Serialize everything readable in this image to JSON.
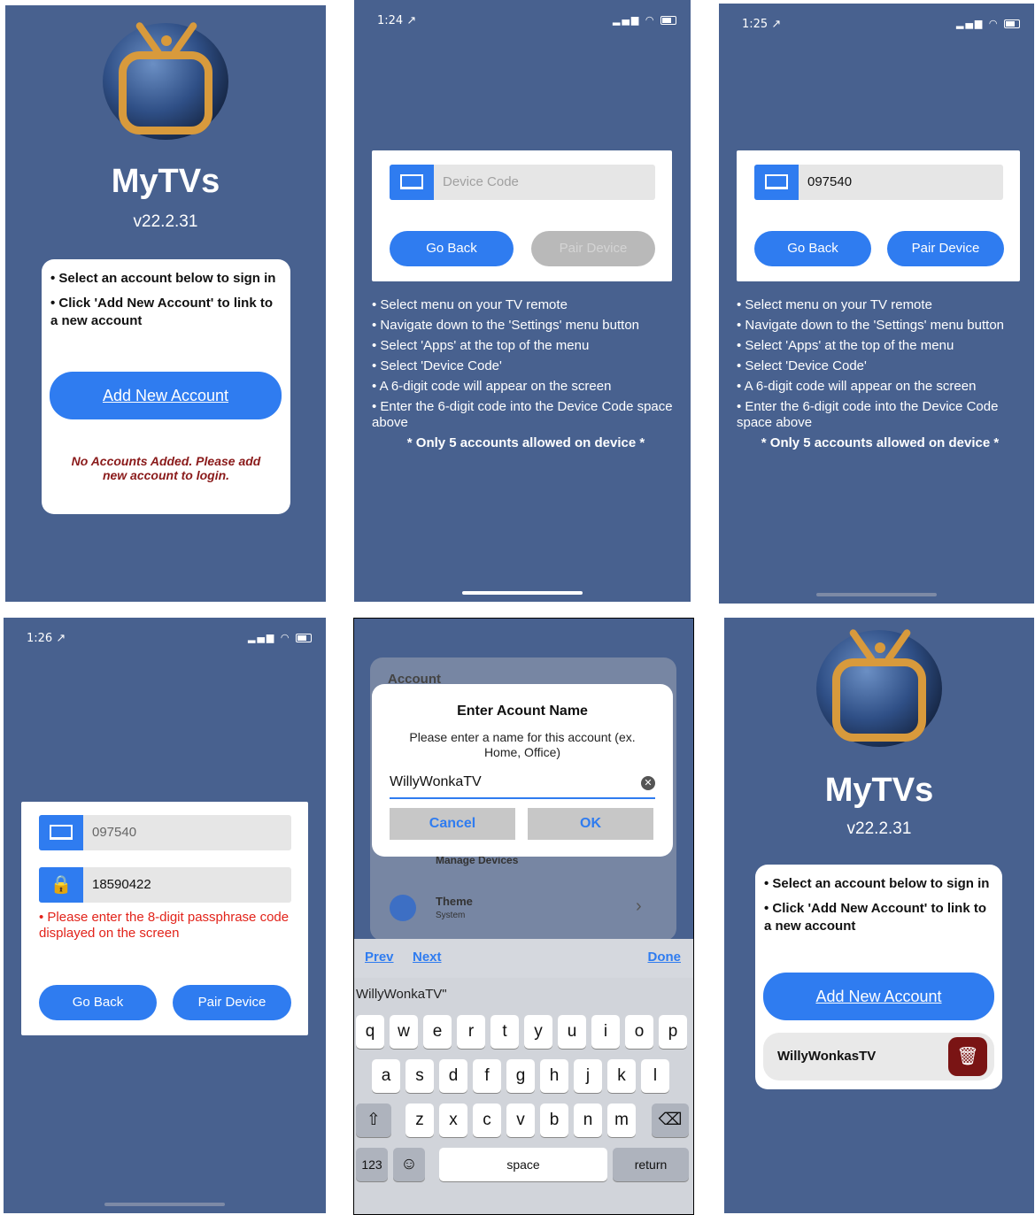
{
  "welcome": {
    "title": "MyTVs",
    "version": "v22.2.31",
    "instructions": [
      "• Select an account below to sign in",
      "• Click 'Add New Account' to link to a new account"
    ],
    "add_button": "Add New Account",
    "empty_message": "No Accounts Added. Please add new account to login."
  },
  "pair_empty": {
    "time": "1:24 ↗",
    "device_code_placeholder": "Device Code",
    "go_back": "Go Back",
    "pair": "Pair Device"
  },
  "pair_filled": {
    "time": "1:25 ↗",
    "device_code": "097540",
    "go_back": "Go Back",
    "pair": "Pair Device"
  },
  "steps": [
    "• Select menu on your TV remote",
    "• Navigate down to the 'Settings' menu button",
    "• Select 'Apps' at the top of the menu",
    "• Select 'Device Code'",
    "• A 6-digit code will appear on the screen",
    "• Enter the 6-digit code into the Device Code space above"
  ],
  "steps_note": "* Only 5 accounts allowed on device *",
  "passphrase": {
    "time": "1:26 ↗",
    "device_code": "097540",
    "passphrase": "18590422",
    "error": "• Please enter the 8-digit passphrase code displayed on the screen",
    "go_back": "Go Back",
    "pair": "Pair Device"
  },
  "dialog": {
    "title": "Enter Acount Name",
    "message": "Please enter a name for this account (ex. Home, Office)",
    "value": "WillyWonkaTV",
    "cancel": "Cancel",
    "ok": "OK",
    "bg_section": "Account",
    "bg_item1": "Manage Devices",
    "bg_item2": "Theme",
    "bg_item2_sub": "System",
    "prev": "Prev",
    "next": "Next",
    "done": "Done",
    "suggestion": "WillyWonkaTV\"",
    "row1": [
      "q",
      "w",
      "e",
      "r",
      "t",
      "y",
      "u",
      "i",
      "o",
      "p"
    ],
    "row2": [
      "a",
      "s",
      "d",
      "f",
      "g",
      "h",
      "j",
      "k",
      "l"
    ],
    "row3": [
      "z",
      "x",
      "c",
      "v",
      "b",
      "n",
      "m"
    ],
    "k123": "123",
    "space": "space",
    "return": "return"
  },
  "accounts": {
    "title": "MyTVs",
    "version": "v22.2.31",
    "instructions": [
      "• Select an account below to sign in",
      "• Click 'Add New Account' to link to a new account"
    ],
    "add_button": "Add New Account",
    "account_name": "WillyWonkasTV"
  }
}
